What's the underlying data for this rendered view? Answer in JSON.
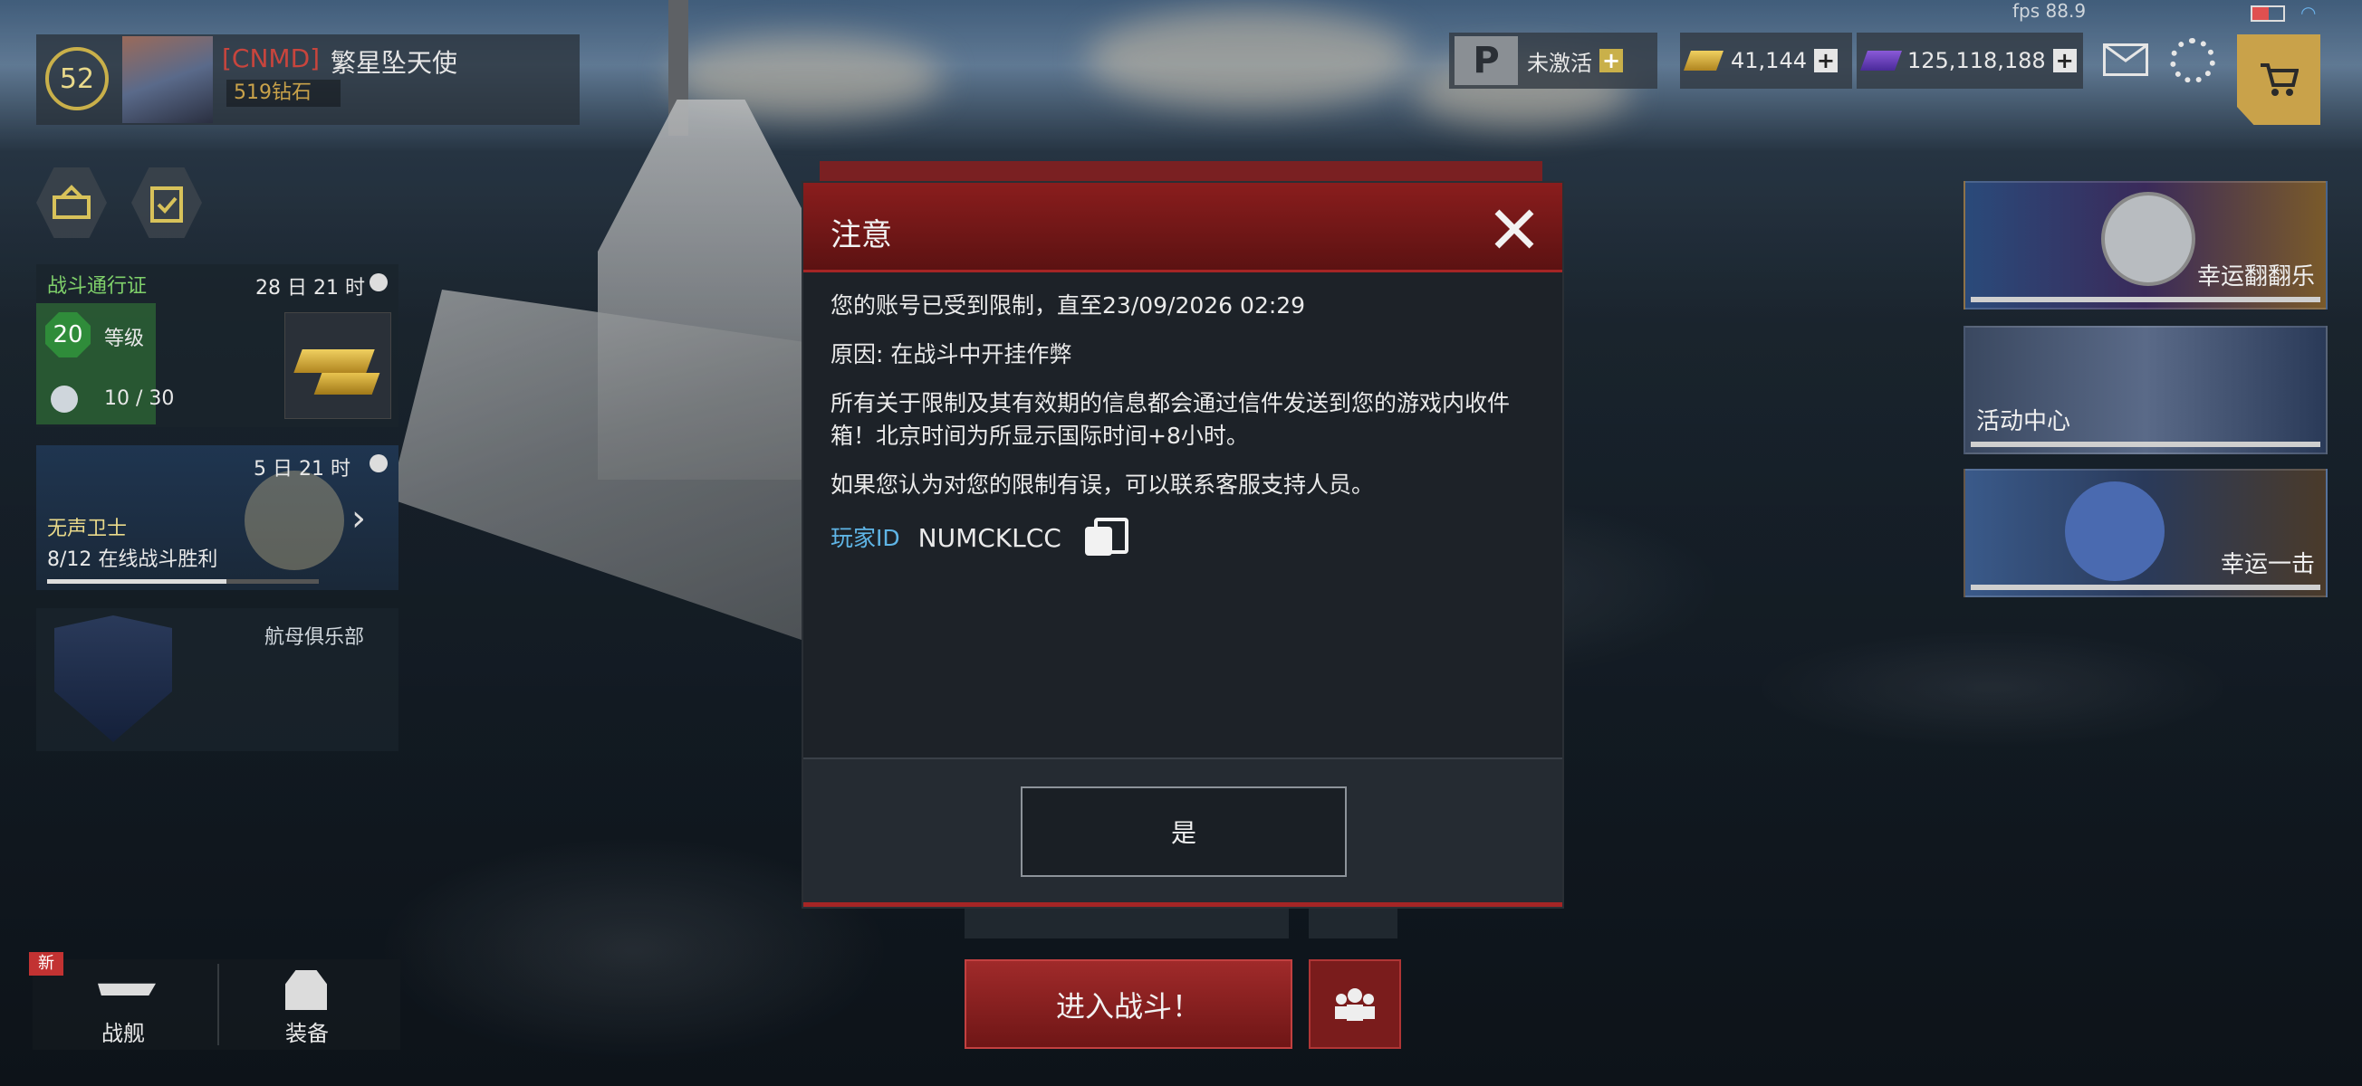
{
  "status": {
    "fps": "fps 88.9"
  },
  "player": {
    "level": "52",
    "clan": "[CNMD]",
    "name": "繁星坠天使",
    "diamonds": "519钻石"
  },
  "topbar": {
    "premium_status": "未激活",
    "gold": "41,144",
    "credits": "125,118,188",
    "icons": [
      "mail-icon",
      "gear-icon",
      "cart-icon"
    ]
  },
  "left_cards": {
    "battle_pass": {
      "title": "战斗通行证",
      "timer": "28 日 21 时",
      "level": "20",
      "level_label": "等级",
      "progress": "10 / 30"
    },
    "event_card": {
      "timer": "5 日 21 时",
      "title": "无声卫士",
      "mission": "8/12 在线战斗胜利"
    },
    "club_card": {
      "title": "航母俱乐部"
    }
  },
  "right_events": [
    {
      "title": "幸运翻翻乐"
    },
    {
      "title": "活动中心"
    },
    {
      "title": "幸运一击"
    }
  ],
  "bottom_nav": {
    "new_badge": "新",
    "items": [
      {
        "label": "战舰"
      },
      {
        "label": "装备"
      }
    ]
  },
  "battle": {
    "enter_label": "进入战斗！"
  },
  "dialog": {
    "title": "注意",
    "line1": "您的账号已受到限制，直至23/09/2026 02:29",
    "line2": "原因: 在战斗中开挂作弊",
    "line3": "所有关于限制及其有效期的信息都会通过信件发送到您的游戏内收件箱！北京时间为所显示国际时间+8小时。",
    "line4": "如果您认为对您的限制有误，可以联系客服支持人员。",
    "player_id_label": "玩家ID",
    "player_id": "NUMCKLCC",
    "ok_label": "是"
  }
}
